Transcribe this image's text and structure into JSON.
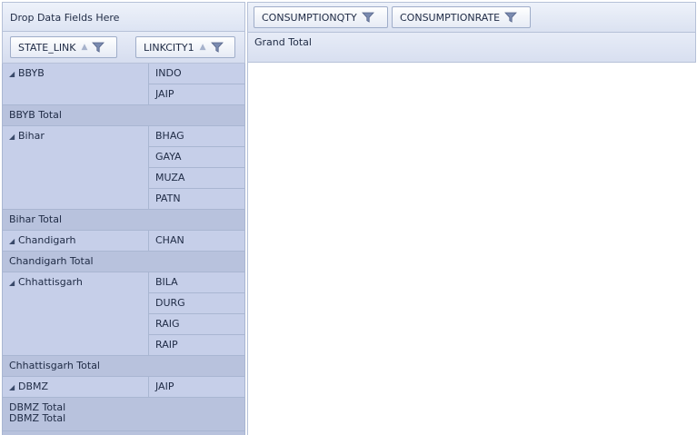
{
  "drop_area": {
    "text": "Drop Data Fields Here"
  },
  "data_fields": [
    {
      "label": "CONSUMPTIONQTY"
    },
    {
      "label": "CONSUMPTIONRATE"
    }
  ],
  "row_fields": [
    {
      "label": "STATE_LINK"
    },
    {
      "label": "LINKCITY1"
    }
  ],
  "column_header": {
    "grand_total": "Grand Total"
  },
  "rows": {
    "bbyb": {
      "state": "BBYB",
      "cities": [
        "INDO",
        "JAIP"
      ],
      "total": "BBYB Total"
    },
    "bihar": {
      "state": "Bihar",
      "cities": [
        "BHAG",
        "GAYA",
        "MUZA",
        "PATN"
      ],
      "total": "Bihar Total"
    },
    "chandigarh": {
      "state": "Chandigarh",
      "cities": [
        "CHAN"
      ],
      "total": "Chandigarh Total"
    },
    "chhattisgarh": {
      "state": "Chhattisgarh",
      "cities": [
        "BILA",
        "DURG",
        "RAIG",
        "RAIP"
      ],
      "total": "Chhattisgarh Total"
    },
    "dbmz": {
      "state": "DBMZ",
      "cities": [
        "JAIP"
      ],
      "total_lines": [
        "DBMZ Total",
        "DBMZ Total"
      ]
    }
  },
  "icons": {
    "filter": "funnel-filter-icon",
    "sort": "sort-ascending-icon",
    "expander": "collapse-triangle-icon"
  },
  "colors": {
    "row_cell": "#c6cfe9",
    "total_row": "#b8c2dd",
    "border": "#a9b6d2"
  }
}
